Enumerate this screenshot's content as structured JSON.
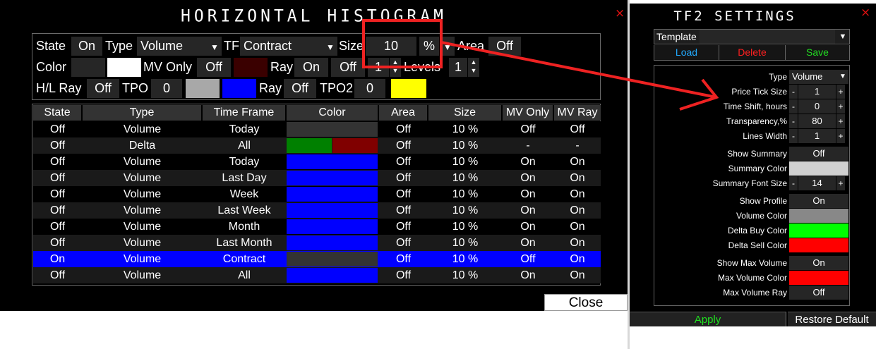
{
  "main_window": {
    "title": "HORIZONTAL HISTOGRAM",
    "close_glyph": "×",
    "controls": {
      "state_label": "State",
      "state_value": "On",
      "type_label": "Type",
      "type_value": "Volume",
      "tf_label": "TF",
      "tf_value": "Contract",
      "size_label": "Size",
      "size_value": "10",
      "size_unit": "%",
      "area_label": "Area",
      "area_value": "Off",
      "color_label": "Color",
      "mv_only_label": "MV Only",
      "mv_only_value": "Off",
      "ray_label": "Ray",
      "ray_value": "On",
      "ray2_value": "Off",
      "ray_stepper_value": "1",
      "levels_label": "Levels",
      "levels_value": "1",
      "hl_ray_label": "H/L Ray",
      "hl_ray_value": "Off",
      "tpo_label": "TPO",
      "tpo_value": "0",
      "tpo_ray_label": "Ray",
      "tpo_ray_value": "Off",
      "tpo2_label": "TPO2",
      "tpo2_value": "0"
    },
    "columns": [
      "State",
      "Type",
      "Time Frame",
      "Color",
      "Area",
      "Size",
      "MV Only",
      "MV Ray"
    ],
    "rows": [
      {
        "state": "Off",
        "type": "Volume",
        "tf": "Today",
        "area": "Off",
        "size": "10 %",
        "mv_only": "Off",
        "mv_ray": "Off"
      },
      {
        "state": "Off",
        "type": "Delta",
        "tf": "All",
        "area": "Off",
        "size": "10 %",
        "mv_only": "-",
        "mv_ray": "-"
      },
      {
        "state": "Off",
        "type": "Volume",
        "tf": "Today",
        "area": "Off",
        "size": "10 %",
        "mv_only": "On",
        "mv_ray": "On"
      },
      {
        "state": "Off",
        "type": "Volume",
        "tf": "Last Day",
        "area": "Off",
        "size": "10 %",
        "mv_only": "On",
        "mv_ray": "On"
      },
      {
        "state": "Off",
        "type": "Volume",
        "tf": "Week",
        "area": "Off",
        "size": "10 %",
        "mv_only": "On",
        "mv_ray": "On"
      },
      {
        "state": "Off",
        "type": "Volume",
        "tf": "Last Week",
        "area": "Off",
        "size": "10 %",
        "mv_only": "On",
        "mv_ray": "On"
      },
      {
        "state": "Off",
        "type": "Volume",
        "tf": "Month",
        "area": "Off",
        "size": "10 %",
        "mv_only": "On",
        "mv_ray": "On"
      },
      {
        "state": "Off",
        "type": "Volume",
        "tf": "Last Month",
        "area": "Off",
        "size": "10 %",
        "mv_only": "On",
        "mv_ray": "On"
      },
      {
        "state": "On",
        "type": "Volume",
        "tf": "Contract",
        "area": "Off",
        "size": "10 %",
        "mv_only": "Off",
        "mv_ray": "On"
      },
      {
        "state": "Off",
        "type": "Volume",
        "tf": "All",
        "area": "Off",
        "size": "10 %",
        "mv_only": "On",
        "mv_ray": "On"
      }
    ],
    "close_button": "Close"
  },
  "settings_window": {
    "title": "TF2 SETTINGS",
    "close_glyph": "×",
    "template_label": "Template",
    "load_label": "Load",
    "delete_label": "Delete",
    "save_label": "Save",
    "type_label": "Type",
    "type_value": "Volume",
    "price_tick_label": "Price Tick Size",
    "price_tick_value": "1",
    "time_shift_label": "Time Shift, hours",
    "time_shift_value": "0",
    "transparency_label": "Transparency,%",
    "transparency_value": "80",
    "lines_width_label": "Lines Width",
    "lines_width_value": "1",
    "show_summary_label": "Show Summary",
    "show_summary_value": "Off",
    "summary_color_label": "Summary Color",
    "summary_font_label": "Summary Font Size",
    "summary_font_value": "14",
    "show_profile_label": "Show Profile",
    "show_profile_value": "On",
    "volume_color_label": "Volume Color",
    "delta_buy_label": "Delta Buy Color",
    "delta_sell_label": "Delta Sell Color",
    "show_max_volume_label": "Show Max Volume",
    "show_max_volume_value": "On",
    "max_volume_color_label": "Max Volume Color",
    "max_volume_ray_label": "Max Volume Ray",
    "max_volume_ray_value": "Off",
    "minus": "-",
    "plus": "+",
    "apply_label": "Apply",
    "restore_label": "Restore Default"
  },
  "colors": {
    "blue": "#0000ff",
    "yellow": "#ffff00",
    "dark_red_swatch": "#3a0000",
    "gray_swatch": "#a8a8a8",
    "green": "#008000",
    "dark_red": "#800000",
    "summary": "#d0d0d0",
    "volume": "#888888",
    "delta_buy": "#00ff00",
    "delta_sell": "#ff0000",
    "max_volume": "#ff0000",
    "annotation_red": "#ee2222",
    "selected_row": "#0000ff"
  },
  "icons": [
    "close-icon",
    "dropdown-arrow-icon",
    "spin-up-icon",
    "spin-down-icon"
  ]
}
